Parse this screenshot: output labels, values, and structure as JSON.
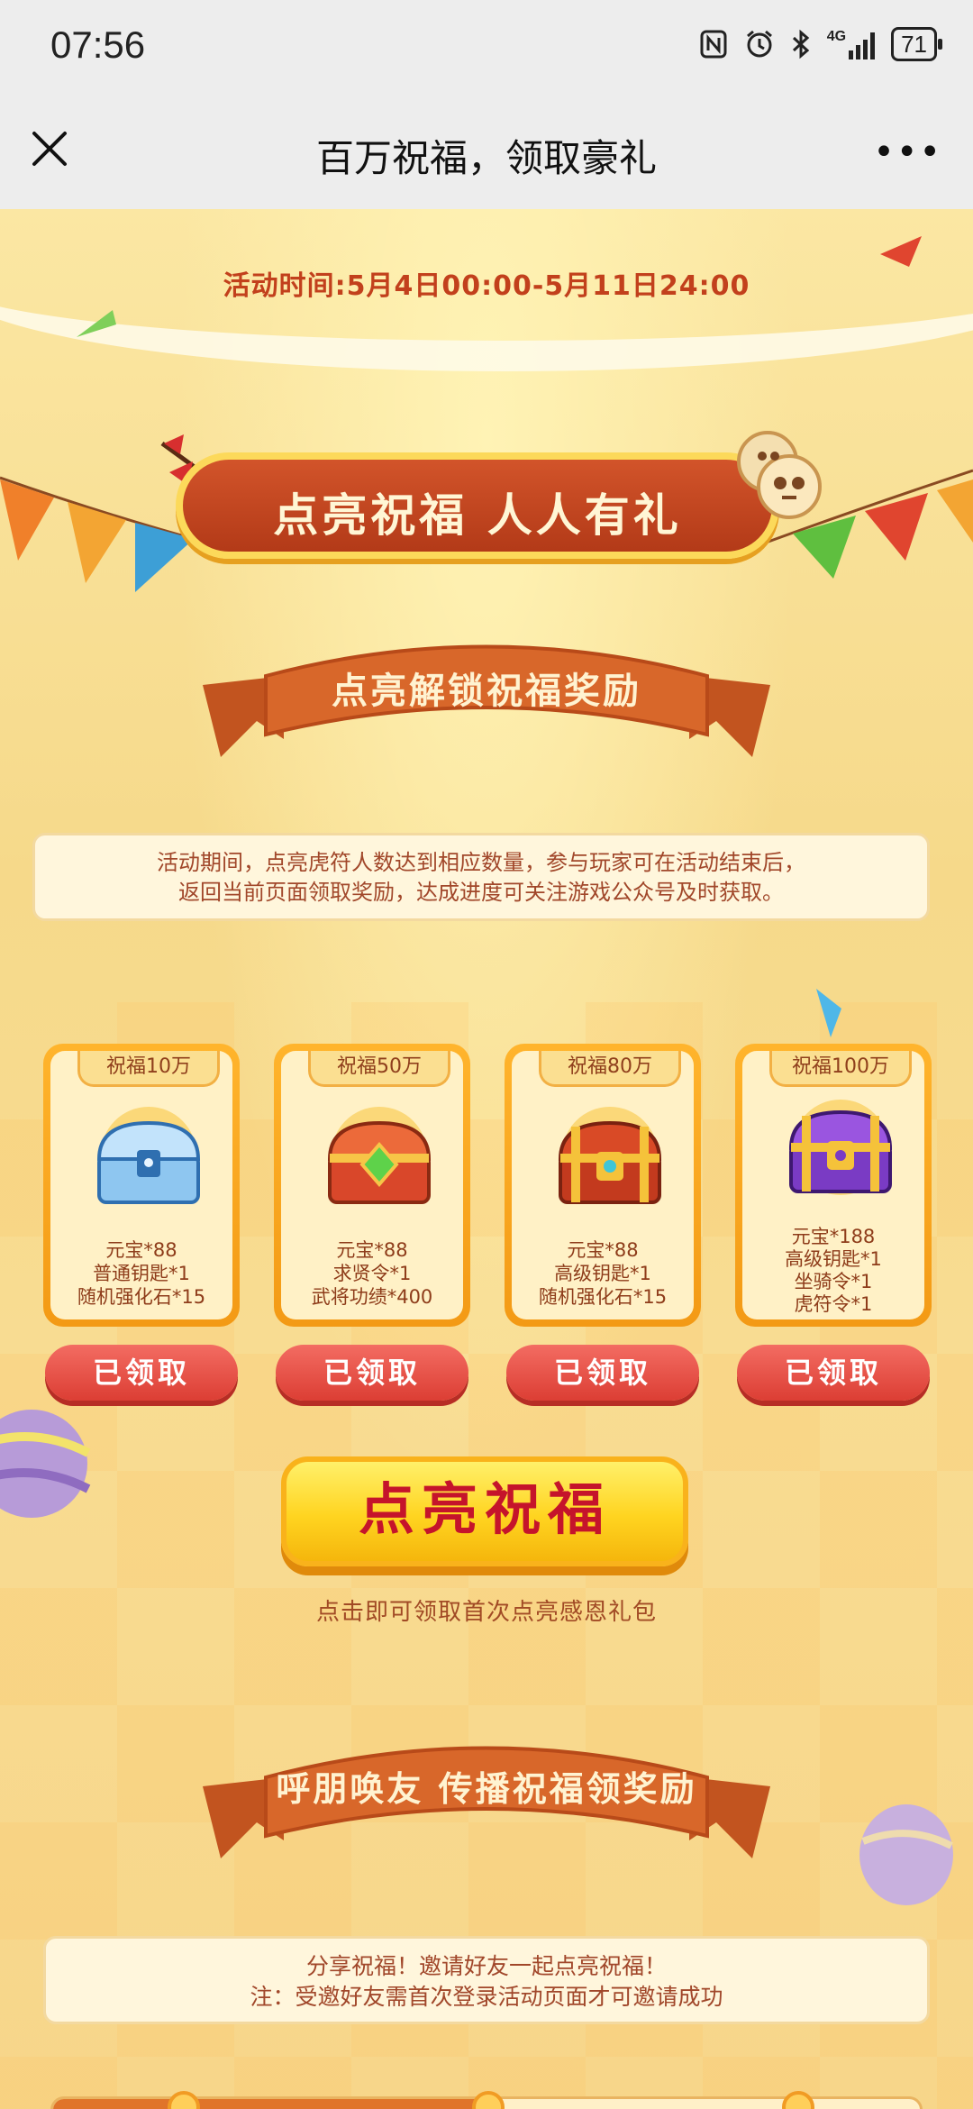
{
  "status_bar": {
    "time": "07:56",
    "icons": [
      "nfc-icon",
      "alarm-icon",
      "bluetooth-icon",
      "signal-4g-icon"
    ],
    "network": "4G",
    "battery": "71"
  },
  "nav": {
    "title": "百万祝福，领取豪礼",
    "more": "•••"
  },
  "event": {
    "time_text": "活动时间:5月4日00:00-5月11日24:00",
    "banner": "点亮祝福 人人有礼"
  },
  "section1": {
    "ribbon": "点亮解锁祝福奖励",
    "info_line1": "活动期间，点亮虎符人数达到相应数量，参与玩家可在活动结束后，",
    "info_line2": "返回当前页面领取奖励，达成进度可关注游戏公众号及时获取。"
  },
  "rewards": [
    {
      "tier": "祝福10万",
      "chest": "blue-chest-icon",
      "lines": [
        "元宝*88",
        "普通钥匙*1",
        "随机强化石*15"
      ],
      "button": "已领取"
    },
    {
      "tier": "祝福50万",
      "chest": "red-chest-icon",
      "lines": [
        "元宝*88",
        "求贤令*1",
        "武将功绩*400"
      ],
      "button": "已领取"
    },
    {
      "tier": "祝福80万",
      "chest": "gold-chest-icon",
      "lines": [
        "元宝*88",
        "高级钥匙*1",
        "随机强化石*15"
      ],
      "button": "已领取"
    },
    {
      "tier": "祝福100万",
      "chest": "purple-chest-icon",
      "lines": [
        "元宝*188",
        "高级钥匙*1",
        "坐骑令*1",
        "虎符令*1"
      ],
      "button": "已领取"
    }
  ],
  "light_button": {
    "label": "点亮祝福",
    "caption": "点击即可领取首次点亮感恩礼包"
  },
  "section2": {
    "ribbon": "呼朋唤友 传播祝福领奖励",
    "info_line1": "分享祝福！邀请好友一起点亮祝福！",
    "info_line2": "注：受邀好友需首次登录活动页面才可邀请成功"
  },
  "colors": {
    "accent_red": "#d2542a",
    "claim_red": "#e0473d",
    "gold": "#ffd420",
    "text_brown": "#8e3c1a"
  }
}
